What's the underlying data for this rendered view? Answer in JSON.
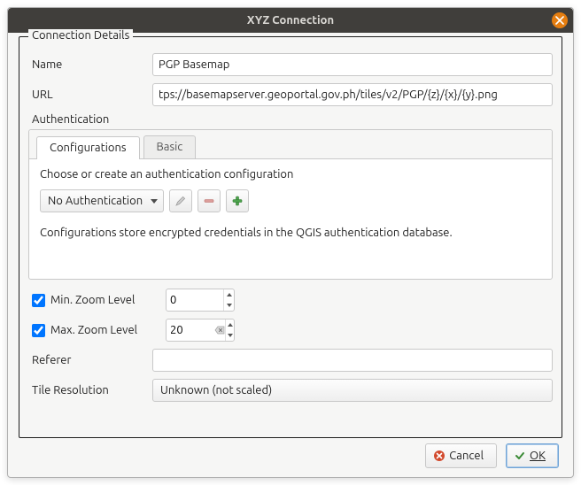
{
  "window": {
    "title": "XYZ Connection"
  },
  "group": {
    "title": "Connection Details",
    "name_label": "Name",
    "name_value": "PGP Basemap",
    "url_label": "URL",
    "url_value": "tps://basemapserver.geoportal.gov.ph/tiles/v2/PGP/{z}/{x}/{y}.png",
    "auth_label": "Authentication"
  },
  "auth": {
    "tabs": {
      "configurations": "Configurations",
      "basic": "Basic"
    },
    "choose_text": "Choose or create an authentication configuration",
    "combo_value": "No Authentication",
    "note": "Configurations store encrypted credentials in the QGIS authentication database."
  },
  "zoom": {
    "min_label": "Min. Zoom Level",
    "min_value": "0",
    "max_label": "Max. Zoom Level",
    "max_value": "20"
  },
  "referer": {
    "label": "Referer",
    "value": ""
  },
  "tileres": {
    "label": "Tile Resolution",
    "value": "Unknown (not scaled)"
  },
  "buttons": {
    "cancel": "Cancel",
    "ok": "OK"
  }
}
